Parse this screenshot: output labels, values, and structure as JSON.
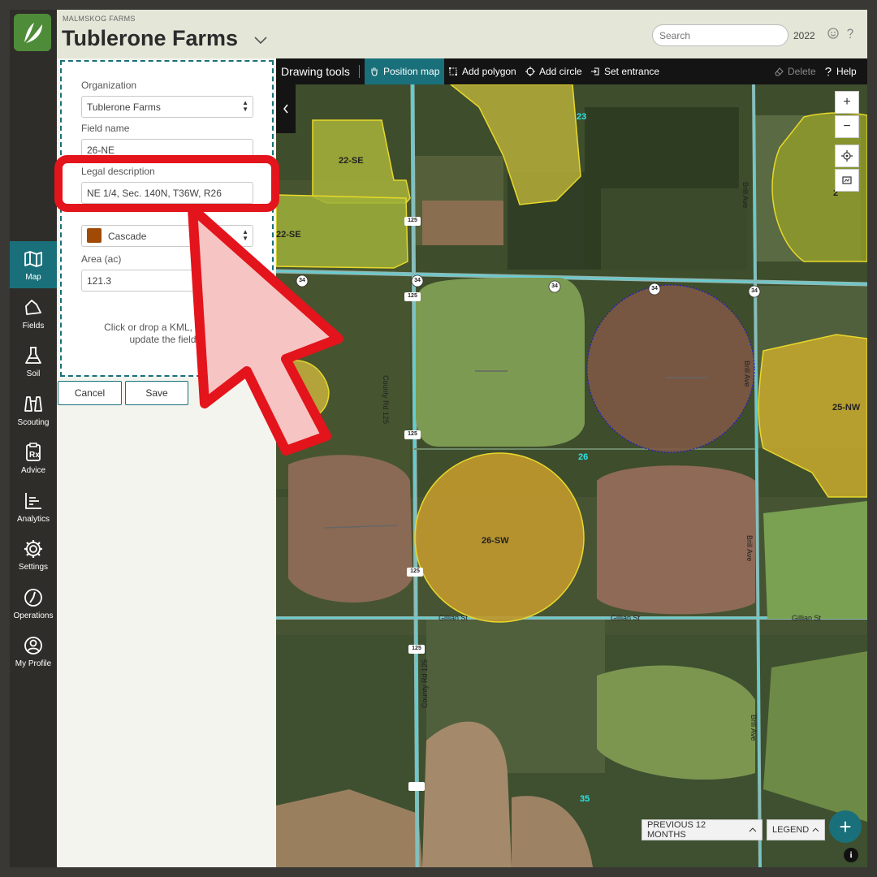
{
  "header": {
    "org_name": "MALMSKOG FARMS",
    "farm_name": "Tublerone Farms",
    "search_placeholder": "Search",
    "year": "2022"
  },
  "nav": [
    {
      "label": "Map",
      "icon": "map-icon",
      "active": true
    },
    {
      "label": "Fields",
      "icon": "fields-icon"
    },
    {
      "label": "Soil",
      "icon": "flask-icon"
    },
    {
      "label": "Scouting",
      "icon": "binoculars-icon"
    },
    {
      "label": "Advice",
      "icon": "prescription-icon"
    },
    {
      "label": "Analytics",
      "icon": "chart-icon"
    },
    {
      "label": "Settings",
      "icon": "gear-icon"
    },
    {
      "label": "Operations",
      "icon": "gauge-icon"
    },
    {
      "label": "My Profile",
      "icon": "profile-icon"
    }
  ],
  "form": {
    "organization_label": "Organization",
    "organization_value": "Tublerone Farms",
    "field_name_label": "Field name",
    "field_name_value": "26-NE",
    "legal_label": "Legal description",
    "legal_value": "NE 1/4, Sec. 140N, T36W, R26",
    "color_value": "Cascade",
    "color_swatch": "#a04a05",
    "area_label": "Area (ac)",
    "area_value": "121.3",
    "drop_line1": "Click or drop a KML, KMZ, or",
    "drop_line2": "update the field b",
    "cancel": "Cancel",
    "save": "Save"
  },
  "toolbar": {
    "title": "Drawing tools",
    "position_map": "Position map",
    "add_polygon": "Add polygon",
    "add_circle": "Add circle",
    "set_entrance": "Set entrance",
    "delete": "Delete",
    "help": "Help"
  },
  "map": {
    "field_labels": [
      "22-SE",
      "22-SE",
      "25-NW",
      "26-SW",
      "2"
    ],
    "section_numbers": [
      "23",
      "26",
      "35"
    ],
    "road_labels": [
      "County Rd 125",
      "County Rd 125",
      "Brill Ave",
      "Brill Ave",
      "Brill Ave",
      "Brill Ave",
      "Gillian St",
      "Gillian St",
      "Gillian St"
    ],
    "shields": [
      "125",
      "125",
      "125",
      "125",
      "125",
      "34",
      "34",
      "34",
      "34",
      "34"
    ],
    "previous_button": "PREVIOUS 12 MONTHS",
    "legend_button": "LEGEND"
  },
  "colors": {
    "accent": "#19707a",
    "callout": "#e3141b",
    "field_outline": "#e8d82a"
  }
}
